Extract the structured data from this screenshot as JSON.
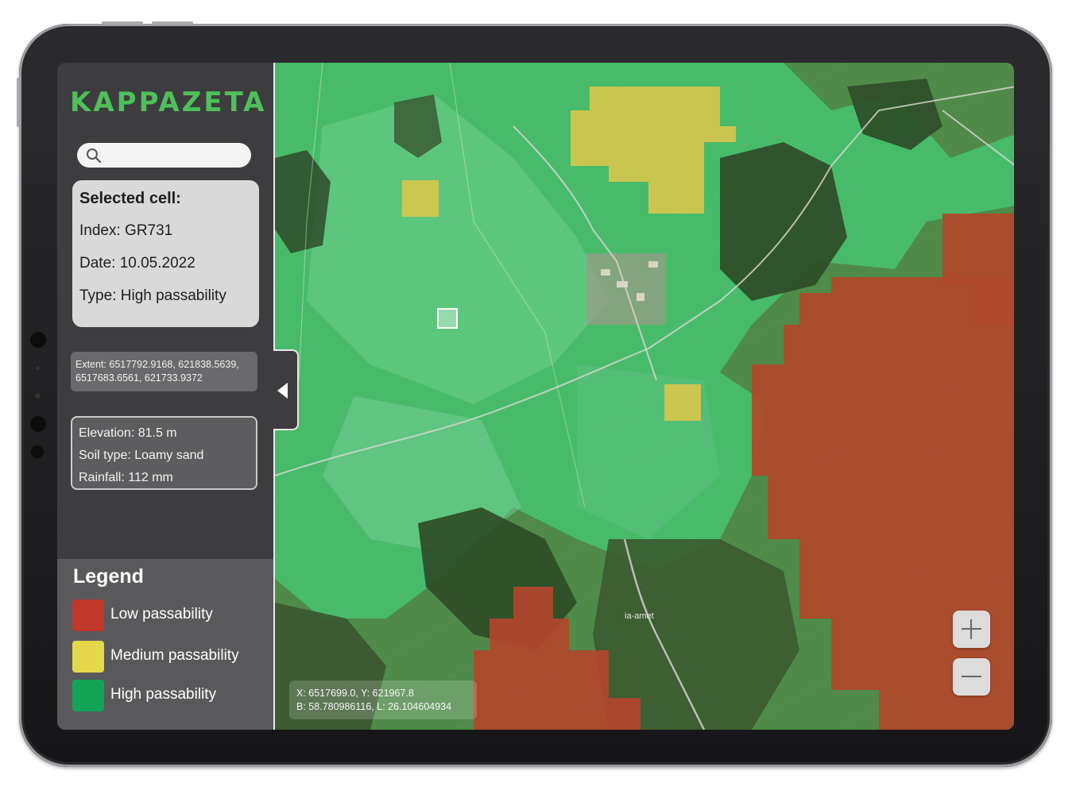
{
  "app": {
    "logo_text": "KAPPAZETA"
  },
  "search": {
    "placeholder": "",
    "value": ""
  },
  "selected_cell": {
    "title": "Selected cell:",
    "index": "Index: GR731",
    "date": "Date: 10.05.2022",
    "type": "Type: High passability"
  },
  "extent": {
    "line1": "Extent: 6517792.9168, 621838.5639,",
    "line2": "6517683.6561, 621733.9372"
  },
  "properties": {
    "elevation": "Elevation: 81.5 m",
    "soil": "Soil type: Loamy sand",
    "rainfall": "Rainfall: 112 mm"
  },
  "legend": {
    "title": "Legend",
    "items": [
      {
        "label": "Low passability",
        "color": "#c0392b"
      },
      {
        "label": "Medium passability",
        "color": "#e5d84a"
      },
      {
        "label": "High passability",
        "color": "#12a454"
      }
    ]
  },
  "map": {
    "place_label": "ia-amet",
    "coords_xy": "X: 6517699.0, Y: 621967.8",
    "coords_bl": "B: 58.780986116, L: 26.104604934",
    "colors": {
      "high": "#3fbf6a",
      "medium": "#d9c84e",
      "low": "#b5452c",
      "forest": "#2d4a26"
    }
  }
}
